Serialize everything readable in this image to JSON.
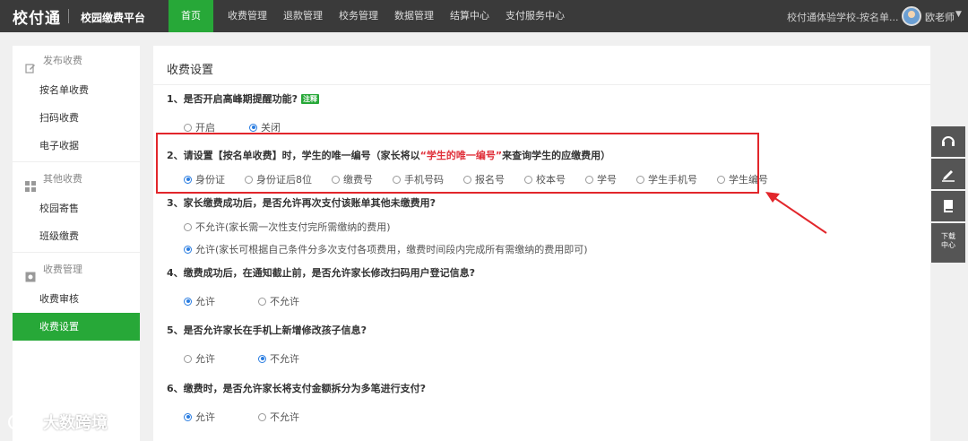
{
  "header": {
    "logo": "校付通",
    "platform": "校园缴费平台",
    "nav": [
      "首页",
      "收费管理",
      "退款管理",
      "校务管理",
      "数据管理",
      "结算中心",
      "支付服务中心"
    ],
    "school": "校付通体验学校-按名单...",
    "username": "欧老师"
  },
  "sidebar": {
    "groups": [
      {
        "label": "发布收费",
        "items": [
          "按名单收费",
          "扫码收费",
          "电子收据"
        ]
      },
      {
        "label": "其他收费",
        "items": [
          "校园寄售",
          "班级缴费"
        ]
      },
      {
        "label": "收费管理",
        "items": [
          "收费审核",
          "收费设置"
        ]
      }
    ]
  },
  "main": {
    "title": "收费设置",
    "questions": [
      {
        "q": "1、是否开启高峰期提醒功能?",
        "tag": "注释",
        "options": [
          "开启",
          "关闭"
        ],
        "selected": 1
      },
      {
        "q_pre": "2、请设置【按名单收费】时，学生的唯一编号（家长将以",
        "q_hl": "“学生的唯一编号”",
        "q_post": "来查询学生的应缴费用）",
        "options": [
          "身份证",
          "身份证后8位",
          "缴费号",
          "手机号码",
          "报名号",
          "校本号",
          "学号",
          "学生手机号",
          "学生编号"
        ],
        "selected": 0
      },
      {
        "q": "3、家长缴费成功后，是否允许再次支付该账单其他未缴费用?",
        "options": [
          "不允许(家长需一次性支付完所需缴纳的费用)",
          "允许(家长可根据自己条件分多次支付各项费用，缴费时间段内完成所有需缴纳的费用即可)"
        ],
        "selected": 1
      },
      {
        "q": "4、缴费成功后，在通知截止前，是否允许家长修改扫码用户登记信息?",
        "options": [
          "允许",
          "不允许"
        ],
        "selected": 0
      },
      {
        "q": "5、是否允许家长在手机上新增修改孩子信息?",
        "options": [
          "允许",
          "不允许"
        ],
        "selected": 1
      },
      {
        "q": "6、缴费时，是否允许家长将支付金额拆分为多笔进行支付?",
        "options": [
          "允许",
          "不允许"
        ],
        "selected": 0
      }
    ]
  },
  "tools": {
    "download": "下载中心"
  },
  "watermark": "大数跨境",
  "colors": {
    "accent": "#27a838",
    "highlight": "#e2262b",
    "radio": "#2a7de1"
  }
}
